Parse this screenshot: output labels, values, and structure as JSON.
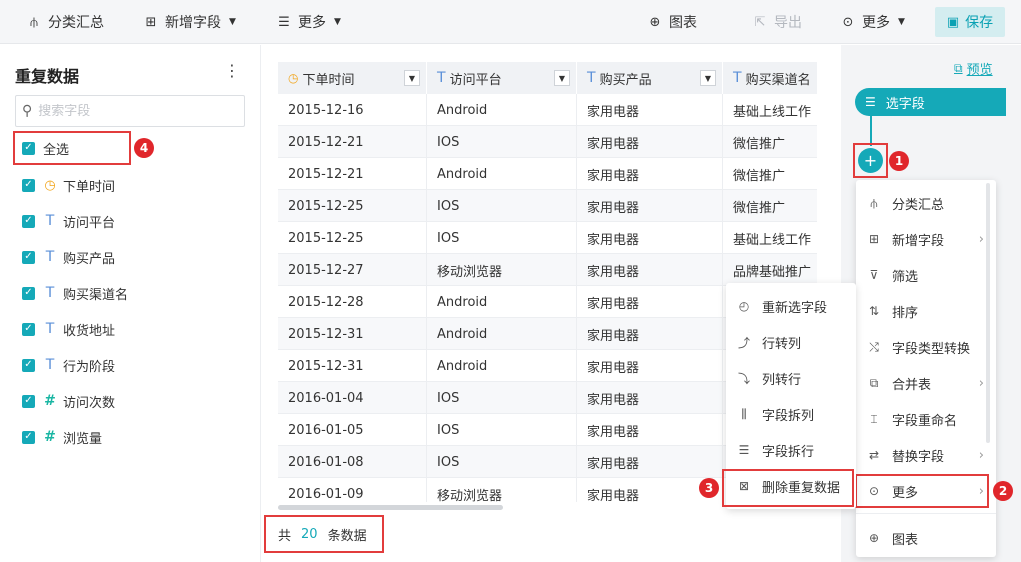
{
  "toolbar": {
    "summary": "分类汇总",
    "add_field": "新增字段",
    "more_left": "更多",
    "chart": "图表",
    "export": "导出",
    "more_right": "更多",
    "save": "保存"
  },
  "left_panel": {
    "title": "重复数据",
    "search_placeholder": "搜索字段",
    "select_all": "全选",
    "fields": [
      {
        "label": "下单时间",
        "type": "time"
      },
      {
        "label": "访问平台",
        "type": "text"
      },
      {
        "label": "购买产品",
        "type": "text"
      },
      {
        "label": "购买渠道名",
        "type": "text"
      },
      {
        "label": "收货地址",
        "type": "text"
      },
      {
        "label": "行为阶段",
        "type": "text"
      },
      {
        "label": "访问次数",
        "type": "number"
      },
      {
        "label": "浏览量",
        "type": "number"
      }
    ]
  },
  "table": {
    "columns": [
      "下单时间",
      "访问平台",
      "购买产品",
      "购买渠道名"
    ],
    "rows": [
      [
        "2015-12-16",
        "Android",
        "家用电器",
        "基础上线工作"
      ],
      [
        "2015-12-21",
        "IOS",
        "家用电器",
        "微信推广"
      ],
      [
        "2015-12-21",
        "Android",
        "家用电器",
        "微信推广"
      ],
      [
        "2015-12-25",
        "IOS",
        "家用电器",
        "微信推广"
      ],
      [
        "2015-12-25",
        "IOS",
        "家用电器",
        "基础上线工作"
      ],
      [
        "2015-12-27",
        "移动浏览器",
        "家用电器",
        "品牌基础推广"
      ],
      [
        "2015-12-28",
        "Android",
        "家用电器",
        ""
      ],
      [
        "2015-12-31",
        "Android",
        "家用电器",
        ""
      ],
      [
        "2015-12-31",
        "Android",
        "家用电器",
        ""
      ],
      [
        "2016-01-04",
        "IOS",
        "家用电器",
        ""
      ],
      [
        "2016-01-05",
        "IOS",
        "家用电器",
        ""
      ],
      [
        "2016-01-08",
        "IOS",
        "家用电器",
        ""
      ],
      [
        "2016-01-09",
        "移动浏览器",
        "家用电器",
        ""
      ]
    ]
  },
  "footer": {
    "prefix": "共",
    "count": "20",
    "suffix": "条数据"
  },
  "right_panel": {
    "preview": "预览",
    "step_label": "选字段",
    "add_symbol": "+",
    "menu": [
      "分类汇总",
      "新增字段",
      "筛选",
      "排序",
      "字段类型转换",
      "合并表",
      "字段重命名",
      "替换字段",
      "更多",
      "图表"
    ],
    "submenu": [
      "重新选字段",
      "行转列",
      "列转行",
      "字段拆列",
      "字段拆行",
      "删除重复数据"
    ]
  },
  "badges": [
    "1",
    "2",
    "3",
    "4"
  ],
  "colors": {
    "accent": "#15a9b8",
    "highlight": "#e23c3c",
    "badge": "#e0262b"
  }
}
